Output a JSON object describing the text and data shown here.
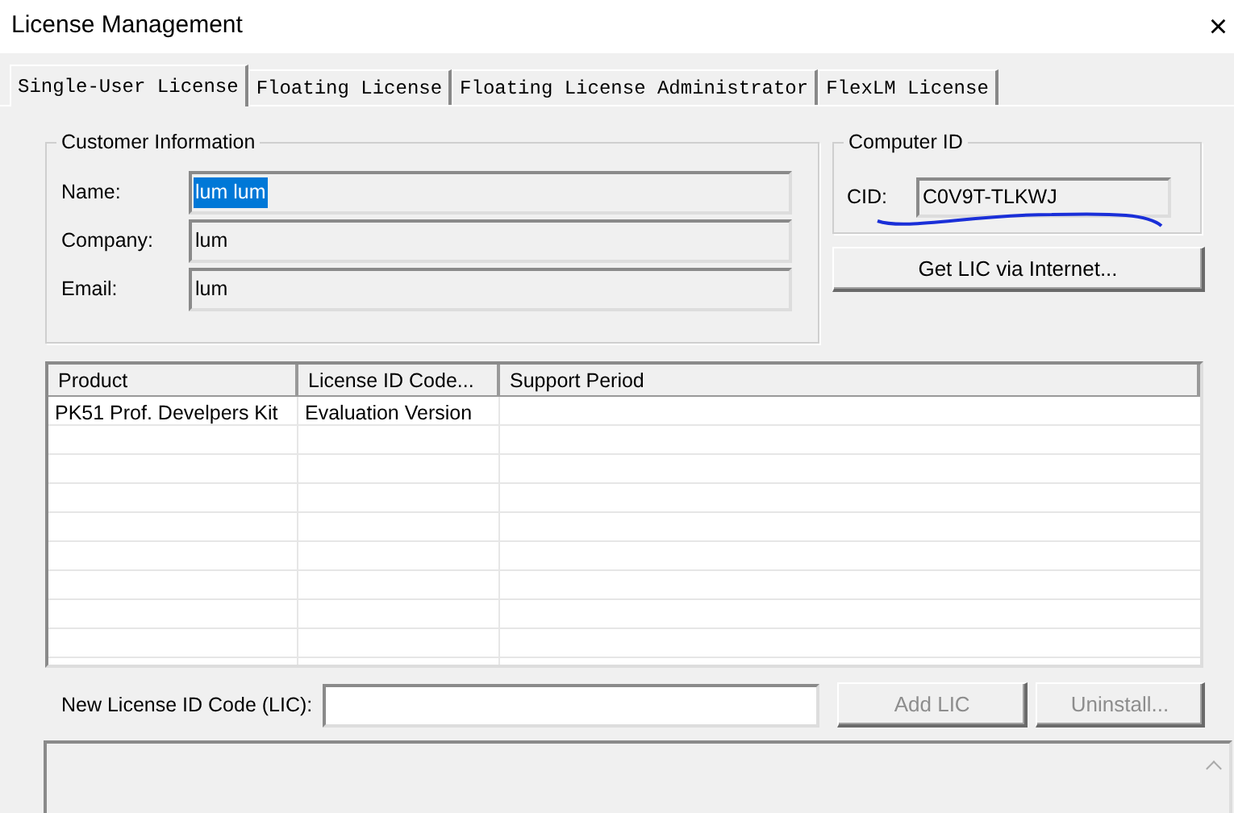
{
  "window": {
    "title": "License Management",
    "close": "×"
  },
  "tabs": [
    {
      "label": "Single-User License",
      "selected": true
    },
    {
      "label": "Floating License",
      "selected": false
    },
    {
      "label": "Floating License Administrator",
      "selected": false
    },
    {
      "label": "FlexLM License",
      "selected": false
    }
  ],
  "customer_information": {
    "title": "Customer Information",
    "fields": [
      {
        "label": "Name:",
        "value": "lum lum",
        "text_selected": true
      },
      {
        "label": "Company:",
        "value": "lum",
        "text_selected": false
      },
      {
        "label": "Email:",
        "value": "lum",
        "text_selected": false
      }
    ]
  },
  "computer_id": {
    "title": "Computer ID",
    "label": "CID:",
    "value": "C0V9T-TLKWJ"
  },
  "get_lic_button": {
    "label": "Get LIC via Internet..."
  },
  "table": {
    "columns": [
      "Product",
      "License ID Code...",
      "Support Period"
    ],
    "rows": [
      [
        "PK51 Prof. Develpers Kit",
        "Evaluation Version",
        ""
      ]
    ]
  },
  "new_lic": {
    "label": "New License ID Code (LIC):"
  },
  "buttons": [
    {
      "label": "Add LIC",
      "disabled": true
    },
    {
      "label": "Uninstall...",
      "disabled": true
    }
  ]
}
